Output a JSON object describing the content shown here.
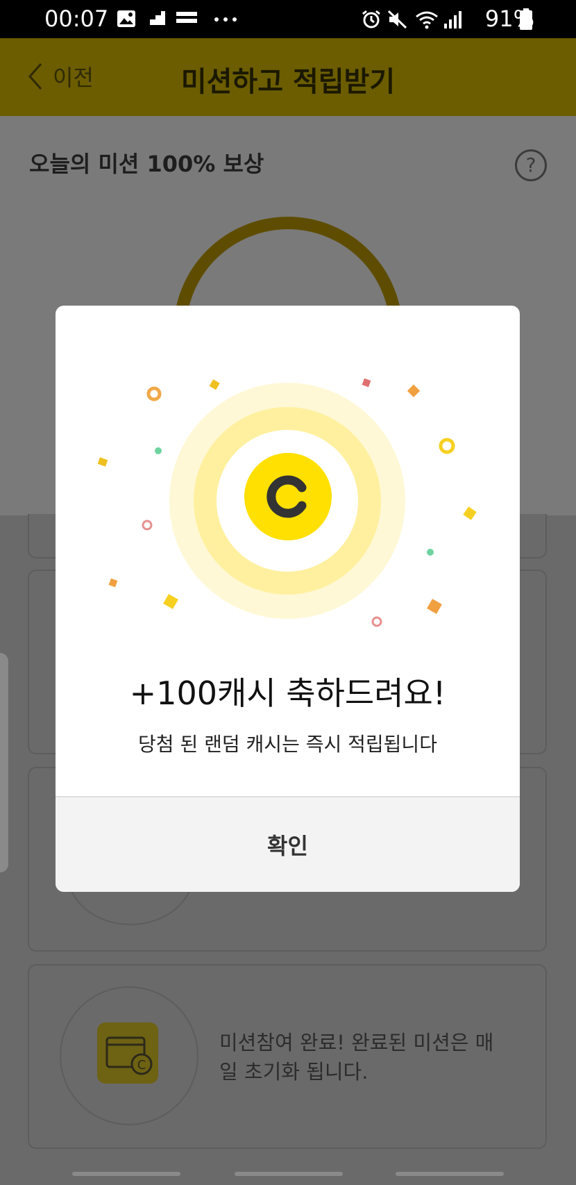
{
  "status_bar": {
    "time": "00:07",
    "battery": "91%",
    "icons": [
      "gallery-icon",
      "cashfeed-icon",
      "more-dots-icon",
      "alarm-icon",
      "mute-icon",
      "wifi-icon",
      "signal-icon",
      "battery-icon"
    ]
  },
  "header": {
    "back_label": "이전",
    "title": "미션하고 적립받기",
    "color": "#6b5d00"
  },
  "mission": {
    "reward_title": "오늘의 미션 100% 보상",
    "help_symbol": "?",
    "complete_text": "미션참여 완료!  완료된 미션은 매일 초기화 됩니다."
  },
  "modal": {
    "title": "+100캐시 축하드려요!",
    "subtitle": "당첨 된 랜덤 캐시는 즉시 적립됩니다",
    "confirm_label": "확인",
    "coin_letter": "C",
    "coin_color": "#ffe000"
  }
}
